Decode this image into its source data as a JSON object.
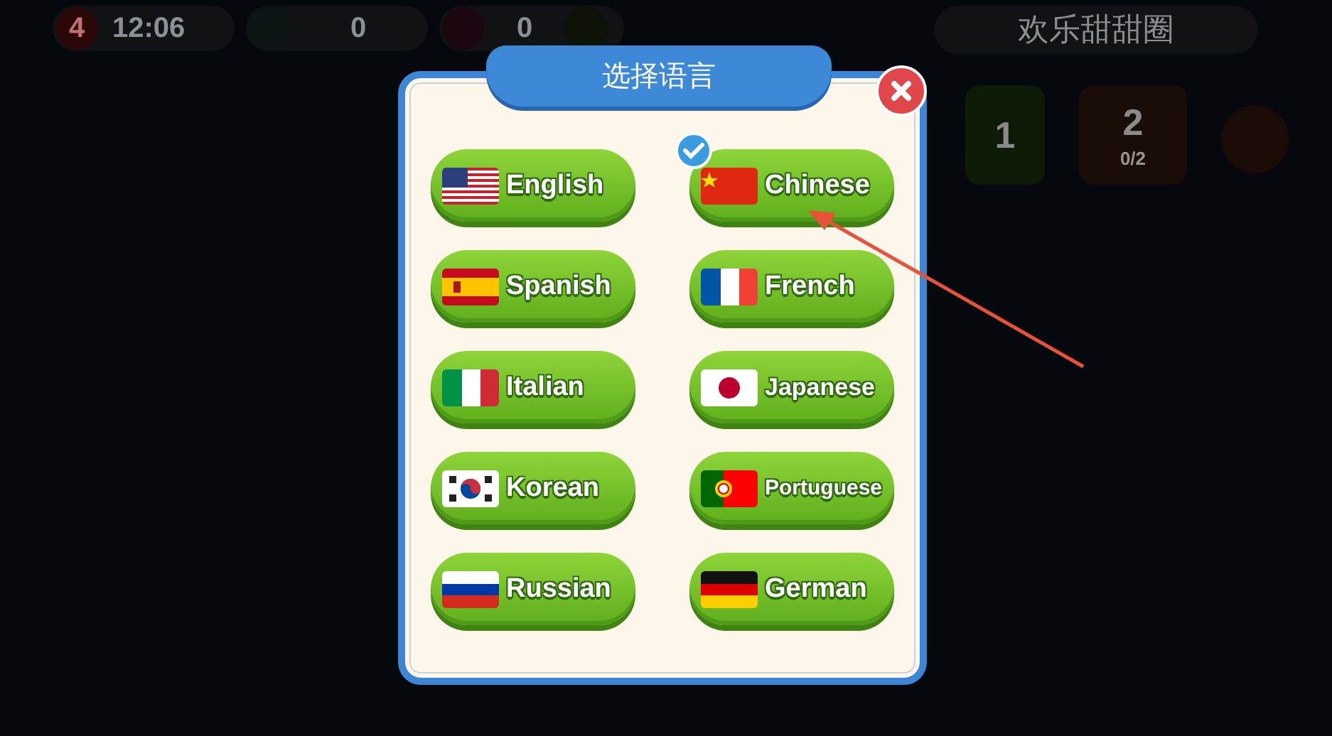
{
  "top_bar": {
    "lives": "4",
    "timer": "12:06",
    "coins": "0",
    "gems": "0"
  },
  "event_title": "欢乐甜甜圈",
  "levels": [
    {
      "number": "1",
      "kind": "done"
    },
    {
      "number": "2",
      "kind": "open",
      "progress": "0/2"
    },
    {
      "kind": "locked"
    }
  ],
  "dialog": {
    "title": "选择语言",
    "languages": [
      {
        "label": "English",
        "kind": "us",
        "selected": false
      },
      {
        "label": "Chinese",
        "kind": "cn",
        "selected": true
      },
      {
        "label": "Spanish",
        "kind": "es",
        "selected": false
      },
      {
        "label": "French",
        "kind": "fr",
        "selected": false
      },
      {
        "label": "Italian",
        "kind": "it",
        "selected": false
      },
      {
        "label": "Japanese",
        "kind": "jp",
        "selected": false
      },
      {
        "label": "Korean",
        "kind": "kr",
        "selected": false
      },
      {
        "label": "Portuguese",
        "kind": "pt",
        "selected": false
      },
      {
        "label": "Russian",
        "kind": "ru",
        "selected": false
      },
      {
        "label": "German",
        "kind": "de",
        "selected": false
      }
    ]
  }
}
